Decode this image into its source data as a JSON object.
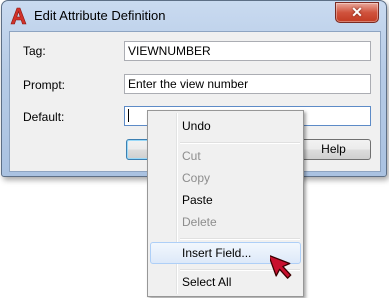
{
  "dialog": {
    "title": "Edit Attribute Definition",
    "close_glyph": "✕",
    "fields": [
      {
        "label": "Tag:",
        "value": "VIEWNUMBER"
      },
      {
        "label": "Prompt:",
        "value": "Enter the view number"
      },
      {
        "label": "Default:",
        "value": ""
      }
    ],
    "buttons": {
      "ok": "",
      "help": "Help"
    }
  },
  "context_menu": {
    "items": [
      {
        "label": "Undo",
        "enabled": true
      },
      {
        "label": "Cut",
        "enabled": false
      },
      {
        "label": "Copy",
        "enabled": false
      },
      {
        "label": "Paste",
        "enabled": true
      },
      {
        "label": "Delete",
        "enabled": false
      },
      {
        "label": "Insert Field...",
        "enabled": true,
        "highlighted": true
      },
      {
        "label": "Select All",
        "enabled": true
      }
    ]
  },
  "colors": {
    "title_bar": "#b6cbe6",
    "close_button": "#c23a22",
    "app_icon": "#d1322a",
    "cursor": "#c8102e",
    "menu_highlight": "#dde9f9"
  },
  "icons": {
    "app": "autocad-a-icon",
    "close": "close-icon",
    "pointer": "red-arrow-cursor-icon"
  }
}
